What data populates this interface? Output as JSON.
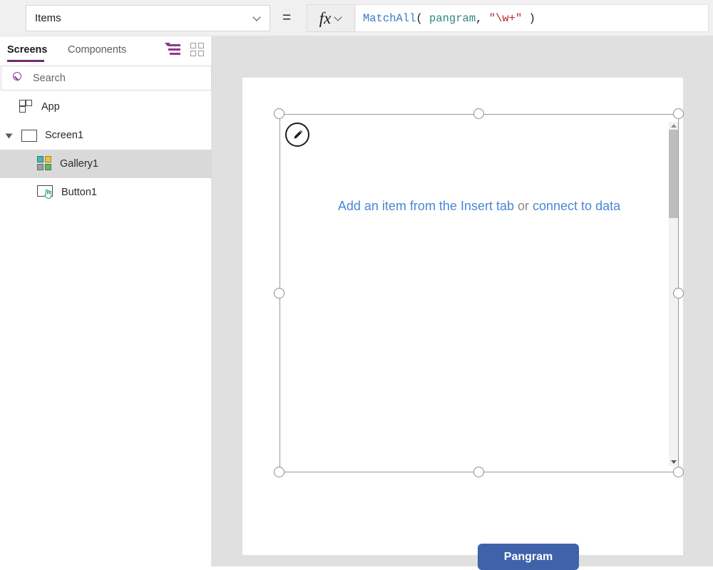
{
  "topbar": {
    "property_selector": {
      "value": "Items",
      "chevron_icon": "chevron-down-icon"
    },
    "equals": "=",
    "fx_label": "fx",
    "formula": {
      "full_text": "MatchAll( pangram, \"\\w+\" )",
      "tokens": [
        {
          "text": "MatchAll",
          "kind": "function"
        },
        {
          "text": "( ",
          "kind": "operator"
        },
        {
          "text": "pangram",
          "kind": "identifier"
        },
        {
          "text": ", ",
          "kind": "operator"
        },
        {
          "text": "\"\\w+\"",
          "kind": "string"
        },
        {
          "text": " )",
          "kind": "operator"
        }
      ],
      "colors": {
        "function": "#3b78c4",
        "identifier": "#2e8b7f",
        "string": "#b02b2b",
        "operator": "#1c1c1c"
      }
    }
  },
  "left_panel": {
    "tabs": [
      {
        "label": "Screens",
        "active": true
      },
      {
        "label": "Components",
        "active": false
      }
    ],
    "view_icons": [
      {
        "name": "tree-view-icon",
        "active": true,
        "color": "#8b3a8b"
      },
      {
        "name": "thumbnail-view-icon",
        "active": false,
        "color": "#9b9b9b"
      }
    ],
    "search": {
      "placeholder": "Search",
      "value": "",
      "icon": "search-icon"
    },
    "tree": [
      {
        "label": "App",
        "icon": "app-icon",
        "indent": 0,
        "selected": false,
        "expander": false
      },
      {
        "label": "Screen1",
        "icon": "screen-icon",
        "indent": 0,
        "selected": false,
        "expander": true
      },
      {
        "label": "Gallery1",
        "icon": "gallery-icon",
        "indent": 1,
        "selected": true,
        "expander": false
      },
      {
        "label": "Button1",
        "icon": "button-icon",
        "indent": 1,
        "selected": false,
        "expander": false
      }
    ]
  },
  "canvas": {
    "gallery": {
      "name": "Gallery1",
      "selected": true,
      "edit_badge_icon": "pencil-icon",
      "empty_state": {
        "link_1": "Add an item from the Insert tab",
        "plain": " or ",
        "link_2": "connect to data",
        "link_color": "#4a86d6",
        "plain_color": "#8a8a8a"
      },
      "scrollbar": {
        "up_arrow_icon": "arrow-up-icon",
        "down_arrow_icon": "arrow-down-icon"
      }
    },
    "button": {
      "label": "Pangram",
      "background_color": "#3f62ab",
      "text_color": "#ffffff"
    }
  }
}
